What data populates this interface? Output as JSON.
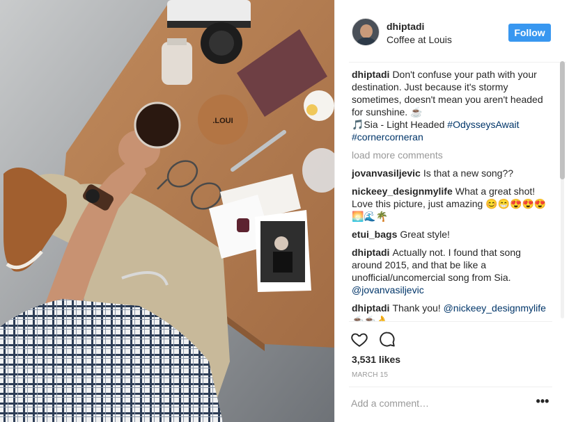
{
  "post": {
    "username": "dhiptadi",
    "location": "Coffee at Louis",
    "follow_label": "Follow",
    "caption": {
      "username": "dhiptadi",
      "text": "Don't confuse your path with your destination. Just because it's stormy sometimes, doesn't mean you aren't headed for sunshine. ☕",
      "music_line": "🎵Sia - Light Headed ",
      "hashtag1": "#OdysseysAwait",
      "hashtag2": "#cornercorneran"
    },
    "load_more_label": "load more comments",
    "comments": [
      {
        "user": "jovanvasiljevic",
        "text": "Is that a new song??"
      },
      {
        "user": "nickeey_designmylife",
        "text": "What a great shot! Love this picture, just amazing 😊😁😍😍😍 🌅🌊🌴"
      },
      {
        "user": "etui_bags",
        "text": "Great style!"
      },
      {
        "user": "dhiptadi",
        "text": "Actually not. I found that song around 2015, and that be like a unofficial/uncomercial song from Sia. ",
        "mention": "@jovanvasiljevic"
      },
      {
        "user": "dhiptadi",
        "text": "Thank you! ",
        "mention": "@nickeey_designmylife",
        "suffix": " ☕☕👌"
      }
    ],
    "likes": "3,531 likes",
    "date": "MARCH 15",
    "add_comment_placeholder": "Add a comment…",
    "more_label": "•••",
    "photo_coaster_text": ".LOUI",
    "icons": {
      "like": "heart-icon",
      "comment": "speech-bubble-icon",
      "more": "more-dots-icon"
    },
    "colors": {
      "follow": "#3897f0",
      "hashtag": "#003569",
      "muted": "#999999"
    }
  }
}
